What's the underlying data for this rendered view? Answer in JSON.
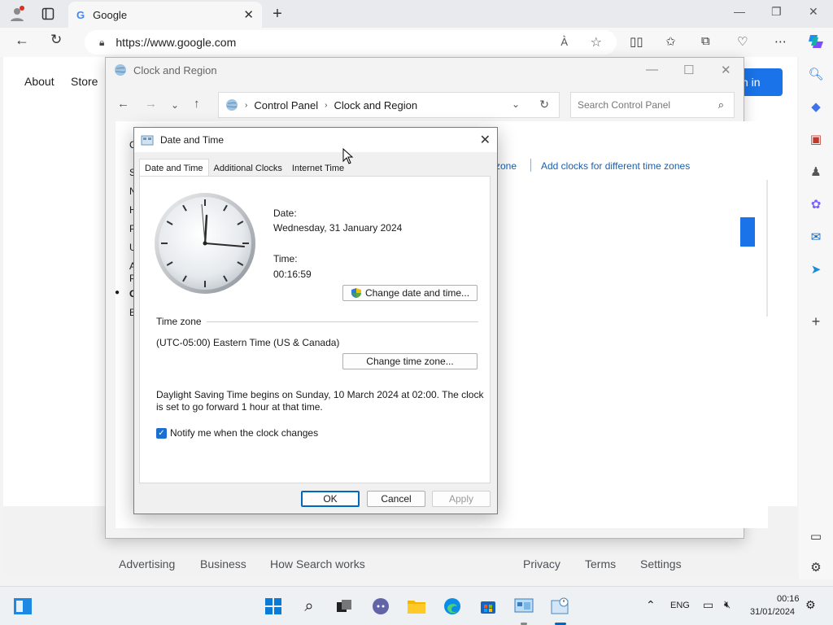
{
  "browser": {
    "tab_title": "Google",
    "url": "https://www.google.com"
  },
  "google": {
    "nav_about": "About",
    "nav_store": "Store",
    "signin_fragment": "n in",
    "footer": [
      "Advertising",
      "Business",
      "How Search works",
      "Privacy",
      "Terms",
      "Settings"
    ]
  },
  "control_panel": {
    "title": "Clock and Region",
    "breadcrumb": [
      "Control Panel",
      "Clock and Region"
    ],
    "search_placeholder": "Search Control Panel",
    "link_partial": "zone",
    "link_add_clocks": "Add clocks for different time zones",
    "left_letters": [
      "C",
      "S",
      "N",
      "H",
      "P",
      "U",
      "A",
      "P",
      "C",
      "E"
    ]
  },
  "dialog": {
    "title": "Date and Time",
    "tabs": [
      "Date and Time",
      "Additional Clocks",
      "Internet Time"
    ],
    "date_label": "Date:",
    "date_value": "Wednesday, 31 January 2024",
    "time_label": "Time:",
    "time_value": "00:16:59",
    "change_datetime_btn": "Change date and time...",
    "timezone_header": "Time zone",
    "timezone_value": "(UTC-05:00) Eastern Time (US & Canada)",
    "change_timezone_btn": "Change time zone...",
    "dst_line1": "Daylight Saving Time begins on Sunday, 10 March 2024 at 02:00. The clock",
    "dst_line2": "is set to go forward 1 hour at that time.",
    "notify_label": "Notify me when the clock changes",
    "ok": "OK",
    "cancel": "Cancel",
    "apply": "Apply"
  },
  "taskbar": {
    "language": "ENG",
    "clock_time": "00:16",
    "clock_date": "31/01/2024"
  },
  "colors": {
    "accent": "#1a73e8",
    "link": "#1b5faa",
    "checkbox": "#1a6fd1"
  }
}
